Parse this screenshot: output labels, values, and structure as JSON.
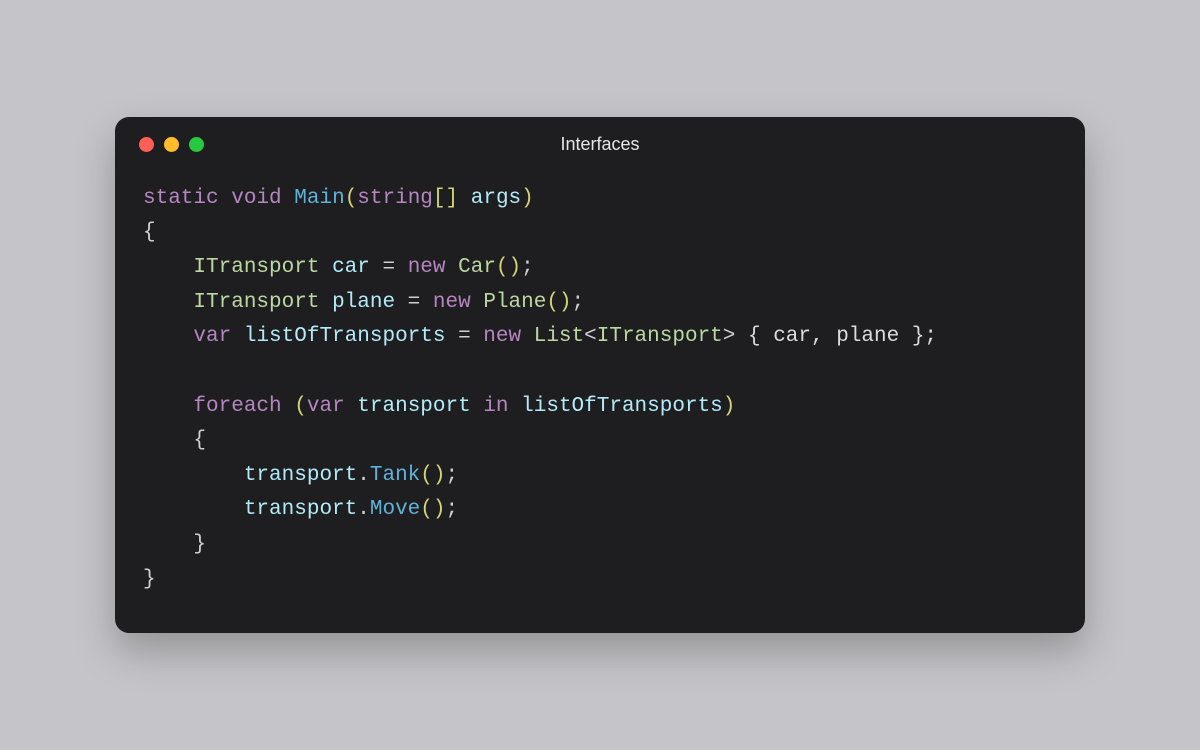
{
  "window": {
    "title": "Interfaces"
  },
  "colors": {
    "background": "#c5c5c9",
    "window_bg": "#1e1e21",
    "traffic_red": "#ff5f56",
    "traffic_yellow": "#ffbd2e",
    "traffic_green": "#27c93f",
    "keyword": "#b586c0",
    "type": "#bbd8a2",
    "method": "#5fb3d9",
    "identifier": "#b2eaf8",
    "punct": "#d0d0d4",
    "paren": "#d4d477",
    "text": "#dcdce0"
  },
  "code": {
    "l1_static": "static",
    "l1_void": "void",
    "l1_main": "Main",
    "l1_paren_open": "(",
    "l1_string": "string",
    "l1_brackets": "[]",
    "l1_args": "args",
    "l1_paren_close": ")",
    "l2_brace_open": "{",
    "l3_indent": "    ",
    "l3_itransport": "ITransport",
    "l3_car_var": "car",
    "l3_eq": " = ",
    "l3_new": "new",
    "l3_car_type": "Car",
    "l3_parens": "()",
    "l3_semi": ";",
    "l4_indent": "    ",
    "l4_itransport": "ITransport",
    "l4_plane_var": "plane",
    "l4_eq": " = ",
    "l4_new": "new",
    "l4_plane_type": "Plane",
    "l4_parens": "()",
    "l4_semi": ";",
    "l5_indent": "    ",
    "l5_var": "var",
    "l5_list_var": "listOfTransports",
    "l5_eq": " = ",
    "l5_new": "new",
    "l5_list": "List",
    "l5_lt": "<",
    "l5_itransport": "ITransport",
    "l5_gt": ">",
    "l5_init": " { car, plane };",
    "l6_blank": "",
    "l7_indent": "    ",
    "l7_foreach": "foreach",
    "l7_space": " ",
    "l7_paren_open": "(",
    "l7_var": "var",
    "l7_transport": "transport",
    "l7_in": "in",
    "l7_list": "listOfTransports",
    "l7_paren_close": ")",
    "l8_indent": "    ",
    "l8_brace_open": "{",
    "l9_indent": "        ",
    "l9_transport": "transport",
    "l9_dot": ".",
    "l9_tank": "Tank",
    "l9_parens": "()",
    "l9_semi": ";",
    "l10_indent": "        ",
    "l10_transport": "transport",
    "l10_dot": ".",
    "l10_move": "Move",
    "l10_parens": "()",
    "l10_semi": ";",
    "l11_indent": "    ",
    "l11_brace_close": "}",
    "l12_brace_close": "}"
  }
}
